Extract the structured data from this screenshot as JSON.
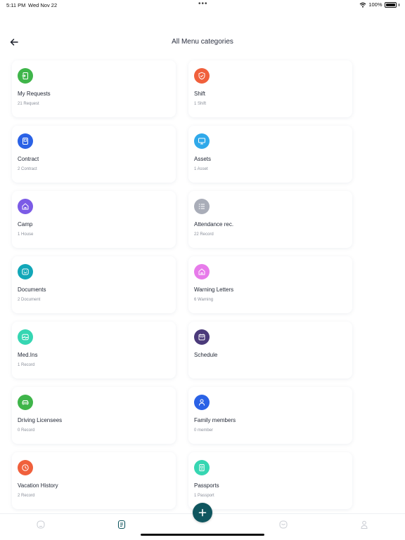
{
  "status": {
    "time": "5:11 PM",
    "date": "Wed Nov 22",
    "battery": "100%"
  },
  "header": {
    "title": "All Menu categories"
  },
  "categories": [
    {
      "title": "My Requests",
      "subtitle": "21 Request",
      "color": "#3fb54a",
      "icon": "request-icon"
    },
    {
      "title": "Shift",
      "subtitle": "1 Shift",
      "color": "#f0603c",
      "icon": "shield-check-icon"
    },
    {
      "title": "Contract",
      "subtitle": "2 Contract",
      "color": "#2a62e6",
      "icon": "contract-icon"
    },
    {
      "title": "Assets",
      "subtitle": "1 Asset",
      "color": "#30a9ea",
      "icon": "monitor-icon"
    },
    {
      "title": "Camp",
      "subtitle": "1 House",
      "color": "#7b5be6",
      "icon": "house-icon"
    },
    {
      "title": "Attendance rec.",
      "subtitle": "22 Record",
      "color": "#a9adb8",
      "icon": "list-icon"
    },
    {
      "title": "Documents",
      "subtitle": "2 Document",
      "color": "#12a7b8",
      "icon": "document-icon"
    },
    {
      "title": "Warning Letters",
      "subtitle": "6 Warning",
      "color": "#e77bea",
      "icon": "warning-house-icon"
    },
    {
      "title": "Med.Ins",
      "subtitle": "1 Record",
      "color": "#36d6b2",
      "icon": "medical-icon"
    },
    {
      "title": "Schedule",
      "subtitle": "",
      "color": "#4b3a7a",
      "icon": "calendar-icon"
    },
    {
      "title": "Driving Licensees",
      "subtitle": "0 Record",
      "color": "#3fb54a",
      "icon": "car-icon"
    },
    {
      "title": "Family members",
      "subtitle": "0 member",
      "color": "#2a62e6",
      "icon": "person-icon"
    },
    {
      "title": "Vacation History",
      "subtitle": "2 Record",
      "color": "#f0603c",
      "icon": "clock-icon"
    },
    {
      "title": "Passports",
      "subtitle": "1 Passport",
      "color": "#36d6b2",
      "icon": "passport-icon"
    }
  ],
  "nav": {
    "items": [
      "home-icon",
      "menu-icon",
      "chat-icon",
      "profile-icon"
    ],
    "active": "menu-icon",
    "fab_icon": "plus-icon"
  }
}
